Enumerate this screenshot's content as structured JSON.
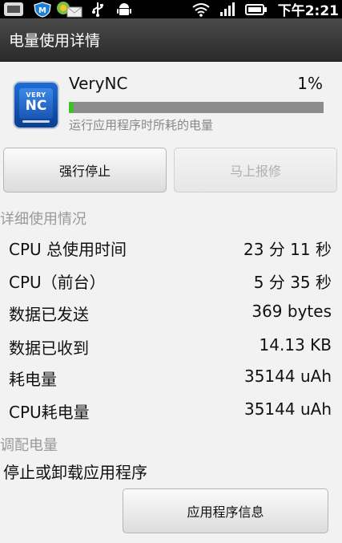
{
  "status_bar": {
    "time": "下午2:21",
    "icons": [
      "notification-icon",
      "shield-icon",
      "mail-icon",
      "usb-icon",
      "android-icon",
      "wifi-icon",
      "signal-icon",
      "battery-icon"
    ]
  },
  "title_bar": {
    "title": "电量使用详情"
  },
  "app": {
    "name": "VeryNC",
    "icon_top": "VERY",
    "icon_main": "NC",
    "percent": "1%",
    "progress_fraction": 0.01,
    "subtitle": "运行应用程序时所耗的电量"
  },
  "buttons": {
    "force_stop": "强行停止",
    "report": "马上报修"
  },
  "details": {
    "header": "详细使用情况",
    "rows": [
      {
        "label": "CPU 总使用时间",
        "value": "23 分 11 秒"
      },
      {
        "label": "CPU（前台）",
        "value": "5 分 35 秒"
      },
      {
        "label": "数据已发送",
        "value": "369 bytes"
      },
      {
        "label": "数据已收到",
        "value": "14.13 KB"
      },
      {
        "label": "耗电量",
        "value": "35144 uAh"
      },
      {
        "label": "CPU耗电量",
        "value": "35144 uAh"
      }
    ]
  },
  "tuning": {
    "header": "调配电量",
    "text": "停止或卸载应用程序",
    "button": "应用程序信息"
  },
  "colors": {
    "progress_fill": "#3fbf2a",
    "progress_track": "#8c8c8c",
    "title_bar": "#333333",
    "section_header": "#999999"
  }
}
